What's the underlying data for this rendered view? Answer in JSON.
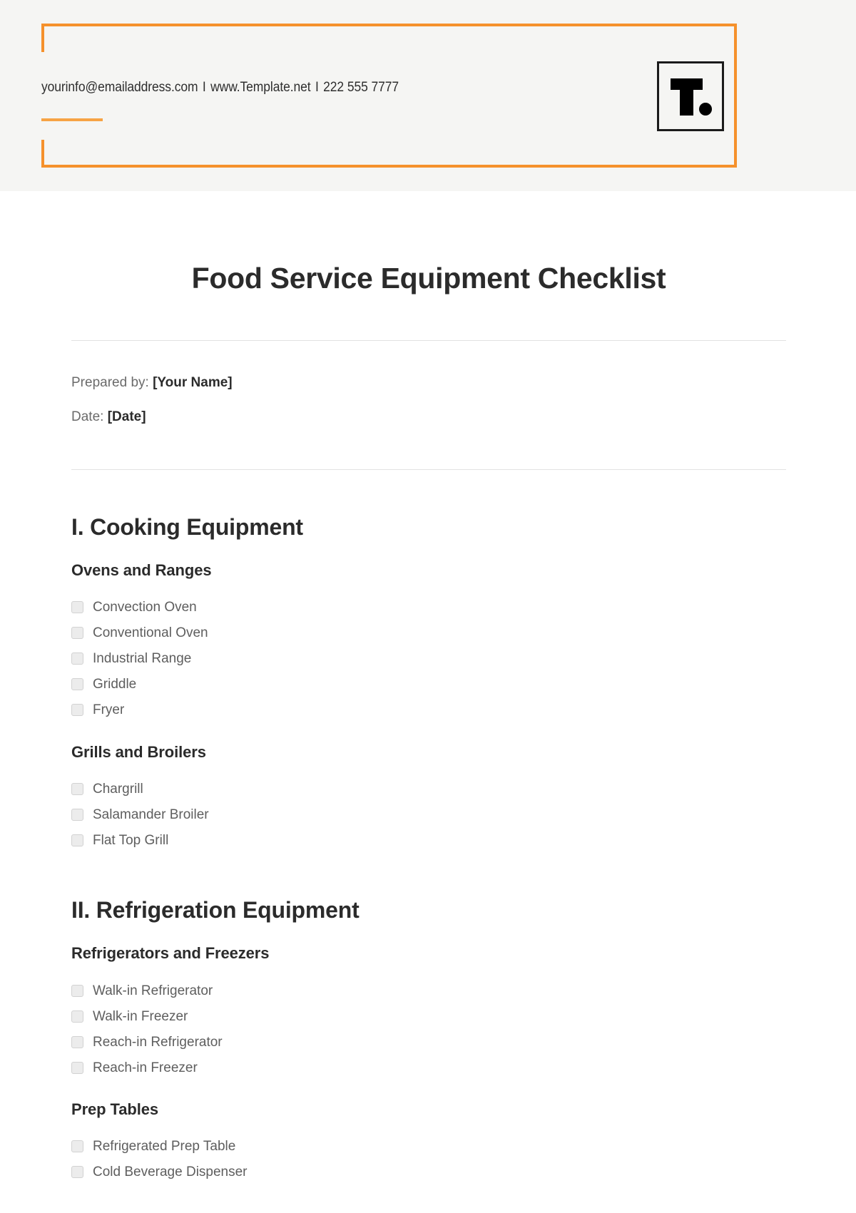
{
  "header": {
    "contact": {
      "email": "yourinfo@emailaddress.com",
      "separator": "I",
      "website": "www.Template.net",
      "phone": "222 555 7777"
    },
    "logo": {
      "letter": "T",
      "name": "template-net-logo"
    },
    "accent_color": "#F5912C",
    "background_color": "#F5F5F3"
  },
  "document": {
    "title": "Food Service Equipment Checklist",
    "meta": [
      {
        "label": "Prepared by:",
        "value": "[Your Name]"
      },
      {
        "label": "Date:",
        "value": "[Date]"
      }
    ],
    "sections": [
      {
        "heading": "I. Cooking Equipment",
        "subsections": [
          {
            "heading": "Ovens and Ranges",
            "items": [
              "Convection Oven",
              "Conventional Oven",
              "Industrial Range",
              "Griddle",
              "Fryer"
            ]
          },
          {
            "heading": "Grills and Broilers",
            "items": [
              "Chargrill",
              "Salamander Broiler",
              "Flat Top Grill"
            ]
          }
        ]
      },
      {
        "heading": "II. Refrigeration Equipment",
        "subsections": [
          {
            "heading": "Refrigerators and Freezers",
            "items": [
              "Walk-in Refrigerator",
              "Walk-in Freezer",
              "Reach-in Refrigerator",
              "Reach-in Freezer"
            ]
          },
          {
            "heading": "Prep Tables",
            "items": [
              "Refrigerated Prep Table",
              "Cold Beverage Dispenser"
            ]
          }
        ]
      }
    ]
  }
}
